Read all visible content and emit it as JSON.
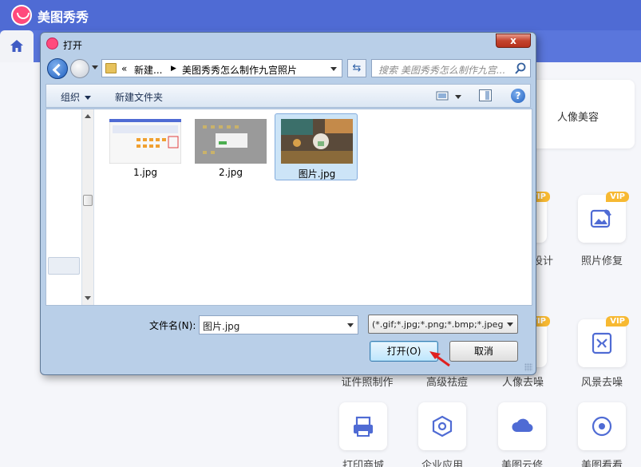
{
  "app": {
    "title": "美图秀秀",
    "banner_label": "人像美容",
    "vip_badge": "VIP",
    "tools": [
      {
        "label": "设计",
        "icon": "design-icon",
        "vip": true
      },
      {
        "label": "照片修复",
        "icon": "photo-repair-icon",
        "vip": true
      },
      {
        "label": "证件照制作",
        "icon": "id-photo-icon",
        "vip": false
      },
      {
        "label": "高级祛痘",
        "icon": "acne-icon",
        "vip": false
      },
      {
        "label": "人像去噪",
        "icon": "portrait-denoise-icon",
        "vip": true
      },
      {
        "label": "风景去噪",
        "icon": "landscape-denoise-icon",
        "vip": true
      },
      {
        "label": "打印商城",
        "icon": "print-icon",
        "vip": false
      },
      {
        "label": "企业应用",
        "icon": "enterprise-icon",
        "vip": false
      },
      {
        "label": "美图云修",
        "icon": "cloud-retouch-icon",
        "vip": false
      },
      {
        "label": "美图看看",
        "icon": "viewer-icon",
        "vip": false
      }
    ]
  },
  "dialog": {
    "title": "打开",
    "close_label": "x",
    "breadcrumb": {
      "prefix": "«",
      "parent": "新建...",
      "current": "美图秀秀怎么制作九宫照片"
    },
    "search_placeholder": "搜索 美图秀秀怎么制作九宫...",
    "toolbar": {
      "organize": "组织",
      "new_folder": "新建文件夹",
      "help": "?"
    },
    "files": [
      {
        "name": "1.jpg",
        "selected": false
      },
      {
        "name": "2.jpg",
        "selected": false
      },
      {
        "name": "图片.jpg",
        "selected": true
      }
    ],
    "filename_label": "文件名(N):",
    "filename_value": "图片.jpg",
    "filter_value": "(*.gif;*.jpg;*.png;*.bmp;*.jpeg",
    "open_button": "打开(O)",
    "cancel_button": "取消"
  },
  "colors": {
    "topbar": "#4f6bd4",
    "vip": "#f7b932",
    "selection": "#cce4f7",
    "arrow": "#e02020"
  }
}
